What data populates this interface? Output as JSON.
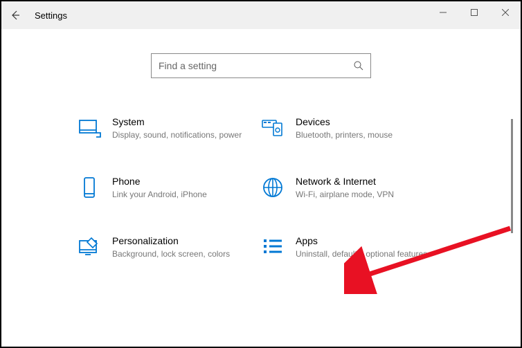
{
  "window": {
    "title": "Settings"
  },
  "search": {
    "placeholder": "Find a setting"
  },
  "tiles": [
    {
      "title": "System",
      "desc": "Display, sound, notifications, power"
    },
    {
      "title": "Devices",
      "desc": "Bluetooth, printers, mouse"
    },
    {
      "title": "Phone",
      "desc": "Link your Android, iPhone"
    },
    {
      "title": "Network & Internet",
      "desc": "Wi-Fi, airplane mode, VPN"
    },
    {
      "title": "Personalization",
      "desc": "Background, lock screen, colors"
    },
    {
      "title": "Apps",
      "desc": "Uninstall, defaults, optional features"
    }
  ]
}
